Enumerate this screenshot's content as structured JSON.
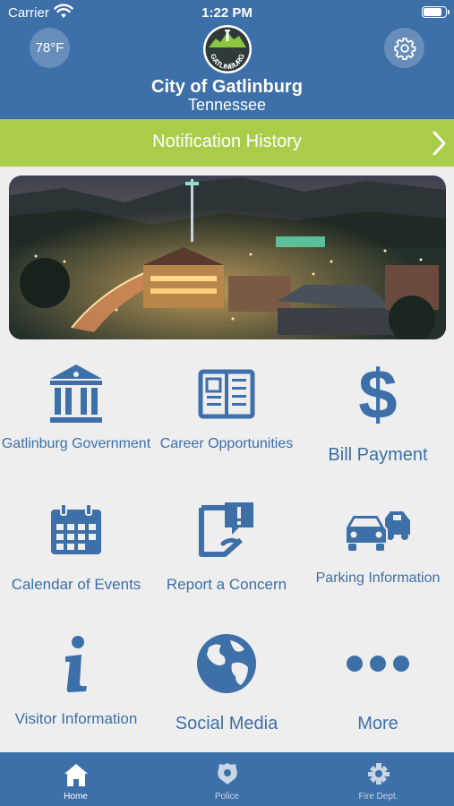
{
  "status_bar": {
    "carrier": "Carrier",
    "time": "1:22 PM",
    "battery_level": 0.9
  },
  "header": {
    "temperature": "78°F",
    "logo_text": "GATLINBURG",
    "city": "City of Gatlinburg",
    "state": "Tennessee"
  },
  "notification_bar": {
    "label": "Notification History"
  },
  "menu": [
    {
      "label": "Gatlinburg Government",
      "icon": "government-building-icon"
    },
    {
      "label": "Career Opportunities",
      "icon": "newspaper-icon"
    },
    {
      "label": "Bill Payment",
      "icon": "dollar-sign-icon"
    },
    {
      "label": "Calendar of Events",
      "icon": "calendar-icon"
    },
    {
      "label": "Report a Concern",
      "icon": "report-concern-icon"
    },
    {
      "label": "Parking Information",
      "icon": "cars-icon"
    },
    {
      "label": "Visitor Information",
      "icon": "info-icon"
    },
    {
      "label": "Social Media",
      "icon": "globe-icon"
    },
    {
      "label": "More",
      "icon": "more-dots-icon"
    }
  ],
  "tabs": [
    {
      "label": "Home",
      "icon": "home-icon",
      "active": true
    },
    {
      "label": "Police",
      "icon": "police-badge-icon",
      "active": false
    },
    {
      "label": "Fire Dept.",
      "icon": "fire-emblem-icon",
      "active": false
    }
  ],
  "colors": {
    "brand_blue": "#3d6fa8",
    "accent_green": "#a9cd49",
    "background": "#eeeeee"
  }
}
